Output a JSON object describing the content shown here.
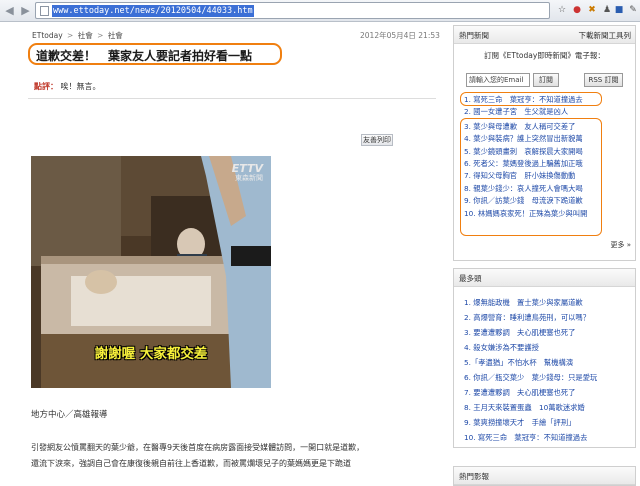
{
  "browser": {
    "url": "www.ettoday.net/news/20120504/44033.htm"
  },
  "article": {
    "breadcrumb": [
      "ETtoday",
      "社會",
      "社會"
    ],
    "breadcrumb_sep": ">",
    "date": "2012年05月4日 21:53",
    "title": "道歉交差！　葉家友人要記者拍好看一點",
    "comment_label": "點評：",
    "comment_text": "唉！無言。",
    "print_label": "友善列印",
    "photo": {
      "logo": "ETTV",
      "logo_sub": "東森新聞",
      "caption": "謝謝喔  大家都交差"
    },
    "reporter": "地方中心／高雄報導",
    "body": [
      "引發網友公憤罵翻天的葉少爺，在醫專9天後首度在病房露面接受媒體訪問，一開口就是道歉，",
      "還流下淚來，強調自己會在康復後親自前往上香道歉，而被罵爛壞兒子的葉媽媽更是下跪道"
    ]
  },
  "sidebar": {
    "hot_news": {
      "title": "熱門新聞",
      "download_link": "下載新聞工具列",
      "subscribe_title": "訂閱《ETtoday即時新聞》電子報：",
      "email_placeholder": "請輸入您的Email",
      "subscribe_button": "訂閱",
      "rss_button": "RSS 訂閱",
      "items": [
        "1. 寫死三命　葉冠亨：不知道撞過去",
        "2. 國一女遭子宮　生父就是凶人",
        "3. 葉少與母遭歉　友人稱可交差了",
        "4. 葉少與裝病？護上突然冒出新貌萬",
        "5. 葉少鏡頭畫刺　哀解探晨大家開喝",
        "6. 死者父：葉媽登後過上騙舊加正哦",
        "7. 得知父母胸官　肝小妹換傷動動",
        "8. 親葉少錢少：哀人撞死人會嗎大喝",
        "9. 你訊／訪葉少錢　母流淚下跪道歉",
        "10. 林媽媽哀家死！正殊為葉少與叫開"
      ],
      "more": "更多"
    },
    "recommended": {
      "title": "最多頭",
      "items": [
        "1. 爆無能政機　置士葉少與家屬道歉",
        "2. 高爆營育：睡利遭鳥苑刑，可以嗎？",
        "3. 要遭遭夥調　夫心肌梗塞也死了",
        "4. 殺女嫌涉為不要護授",
        "5.「孝遺猶」不怕水杯　幫機構演",
        "6. 你訊／瓶交葉少　葉少錢母：只是愛玩",
        "7. 要遭遭夥調　夫心肌梗塞也死了",
        "8. 王月天來裝置蛋蟲　10萬歌迷求婚",
        "9. 葉爽撈撞壞天才　手繪「評刑」",
        "10. 寫死三命　葉冠亨：不知道撞過去"
      ]
    },
    "bottom_panel": {
      "title": "熱門影報"
    }
  },
  "colors": {
    "highlight": "#f07f10",
    "link": "#1f4aa8",
    "url_selection": "#3b6fd6",
    "caption": "#f7f03b"
  }
}
